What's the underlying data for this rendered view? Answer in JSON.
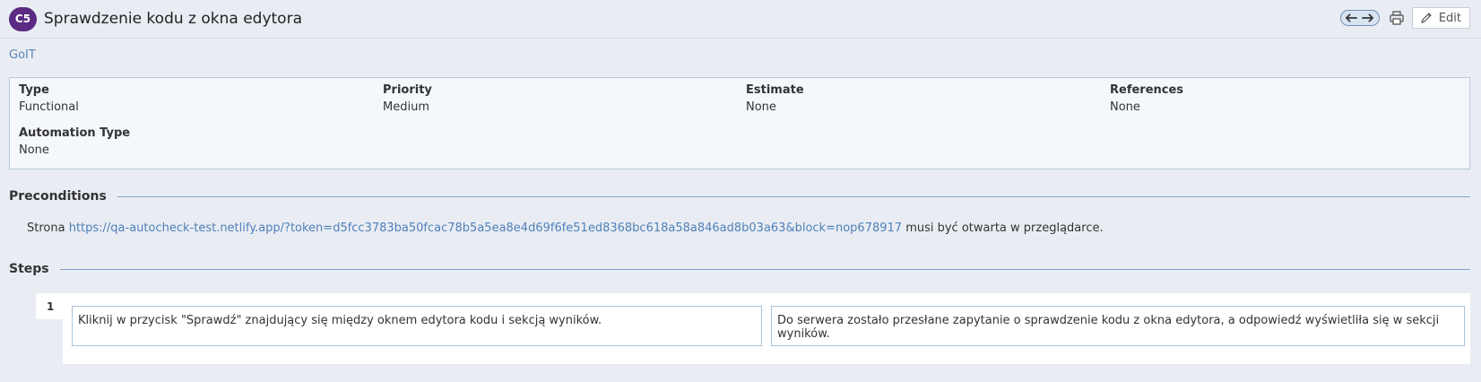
{
  "header": {
    "case_id": "C5",
    "title": "Sprawdzenie kodu z okna edytora",
    "edit_label": "Edit",
    "icons": [
      "arrow-left-icon",
      "arrow-right-icon",
      "print-icon",
      "pencil-icon"
    ]
  },
  "project": "GoIT",
  "fields": {
    "type": {
      "label": "Type",
      "value": "Functional"
    },
    "priority": {
      "label": "Priority",
      "value": "Medium"
    },
    "estimate": {
      "label": "Estimate",
      "value": "None"
    },
    "references": {
      "label": "References",
      "value": "None"
    },
    "automation_type": {
      "label": "Automation Type",
      "value": "None"
    }
  },
  "preconditions": {
    "title": "Preconditions",
    "text_before": "Strona ",
    "url": "https://qa-autocheck-test.netlify.app/?token=d5fcc3783ba50fcac78b5a5ea8e4d69f6fe51ed8368bc618a58a846ad8b03a63&block=nop678917",
    "text_after": " musi być otwarta w przeglądarce."
  },
  "steps": {
    "title": "Steps",
    "items": [
      {
        "number": "1",
        "action": "Kliknij w przycisk \"Sprawdź\" znajdujący się między oknem edytora kodu i sekcją wyników.",
        "expected": "Do serwera zostało przesłane zapytanie o sprawdzenie kodu z okna edytora, a odpowiedź wyświetliła się w sekcji wyników."
      }
    ]
  },
  "colors": {
    "badge": "#5b2a82",
    "link": "#5a86b8",
    "background": "#e9edf3"
  }
}
